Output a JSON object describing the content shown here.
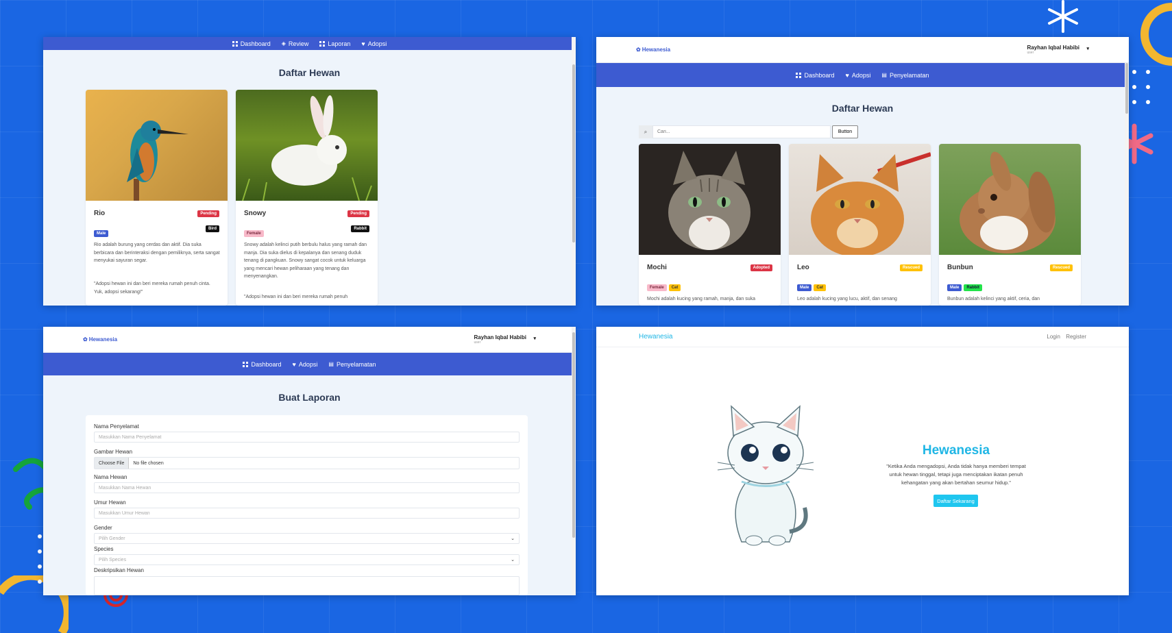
{
  "panel_tl": {
    "nav": [
      "Dashboard",
      "Review",
      "Laporan",
      "Adopsi"
    ],
    "title": "Daftar Hewan",
    "cards": [
      {
        "name": "Rio",
        "status": "Pending",
        "gender": "Male",
        "species": "Bird",
        "desc": "Rio adalah burung yang cerdas dan aktif. Dia suka berbicara dan berinteraksi dengan pemiliknya, serta sangat menyukai sayuran segar.",
        "quote": "\"Adopsi hewan ini dan beri mereka rumah penuh cinta. Yuk, adopsi sekarang!\""
      },
      {
        "name": "Snowy",
        "status": "Pending",
        "gender": "Female",
        "species": "Rabbit",
        "desc": "Snowy adalah kelinci putih berbulu halus yang ramah dan manja. Dia suka dielus di kepalanya dan senang duduk tenang di pangkuan. Snowy sangat cocok untuk keluarga yang mencari hewan peliharaan yang tenang dan menyenangkan.",
        "quote": "\"Adopsi hewan ini dan beri mereka rumah penuh"
      }
    ]
  },
  "panel_tr": {
    "brand": "Hewanesia",
    "user_name": "Rayhan Iqbal Habibi",
    "user_role": "user",
    "nav": [
      "Dashboard",
      "Adopsi",
      "Penyelamatan"
    ],
    "title": "Daftar Hewan",
    "search_placeholder": "Cari...",
    "search_button": "Button",
    "cards": [
      {
        "name": "Mochi",
        "status": "Adopted",
        "gender": "Female",
        "species": "Cat",
        "desc": "Mochi adalah kucing yang ramah, manja, dan suka"
      },
      {
        "name": "Leo",
        "status": "Rescued",
        "gender": "Male",
        "species": "Cat",
        "desc": "Leo adalah kucing yang lucu, aktif, dan senang"
      },
      {
        "name": "Bunbun",
        "status": "Rescued",
        "gender": "Male",
        "species": "Rabbit",
        "desc": "Bunbun adalah kelinci yang aktif, ceria, dan"
      }
    ]
  },
  "panel_bl": {
    "brand": "Hewanesia",
    "user_name": "Rayhan Iqbal Habibi",
    "user_role": "user",
    "nav": [
      "Dashboard",
      "Adopsi",
      "Penyelamatan"
    ],
    "title": "Buat Laporan",
    "fields": {
      "rescuer_label": "Nama Penyelamat",
      "rescuer_placeholder": "Masukkan Nama Penyelamat",
      "image_label": "Gambar Hewan",
      "file_button": "Choose File",
      "file_status": "No file chosen",
      "name_label": "Nama Hewan",
      "name_placeholder": "Masukkan Nama Hewan",
      "age_label": "Umur Hewan",
      "age_placeholder": "Masukkan Umur Hewan",
      "gender_label": "Gender",
      "gender_value": "Pilih Gender",
      "species_label": "Species",
      "species_value": "Pilih Species",
      "desc_label": "Deskripsikan Hewan"
    }
  },
  "panel_br": {
    "brand": "Hewanesia",
    "login": "Login",
    "register": "Register",
    "hero_title": "Hewanesia",
    "hero_text": "\"Ketika Anda mengadopsi, Anda tidak hanya memberi tempat untuk hewan tinggal, tetapi juga menciptakan ikatan penuh kehangatan yang akan bertahan seumur hidup.\"",
    "cta": "Daftar Sekarang"
  },
  "colors": {
    "background": "#1a66e3",
    "nav": "#3d5bd1",
    "pending": "#dc3545",
    "adopted": "#dc3545",
    "rescued": "#ffc107",
    "male": "#3d5bd1",
    "female": "#f8b9c9",
    "cat": "#ffc107",
    "rabbit_tag": "#22e34a",
    "accent": "#1fb6e5"
  }
}
